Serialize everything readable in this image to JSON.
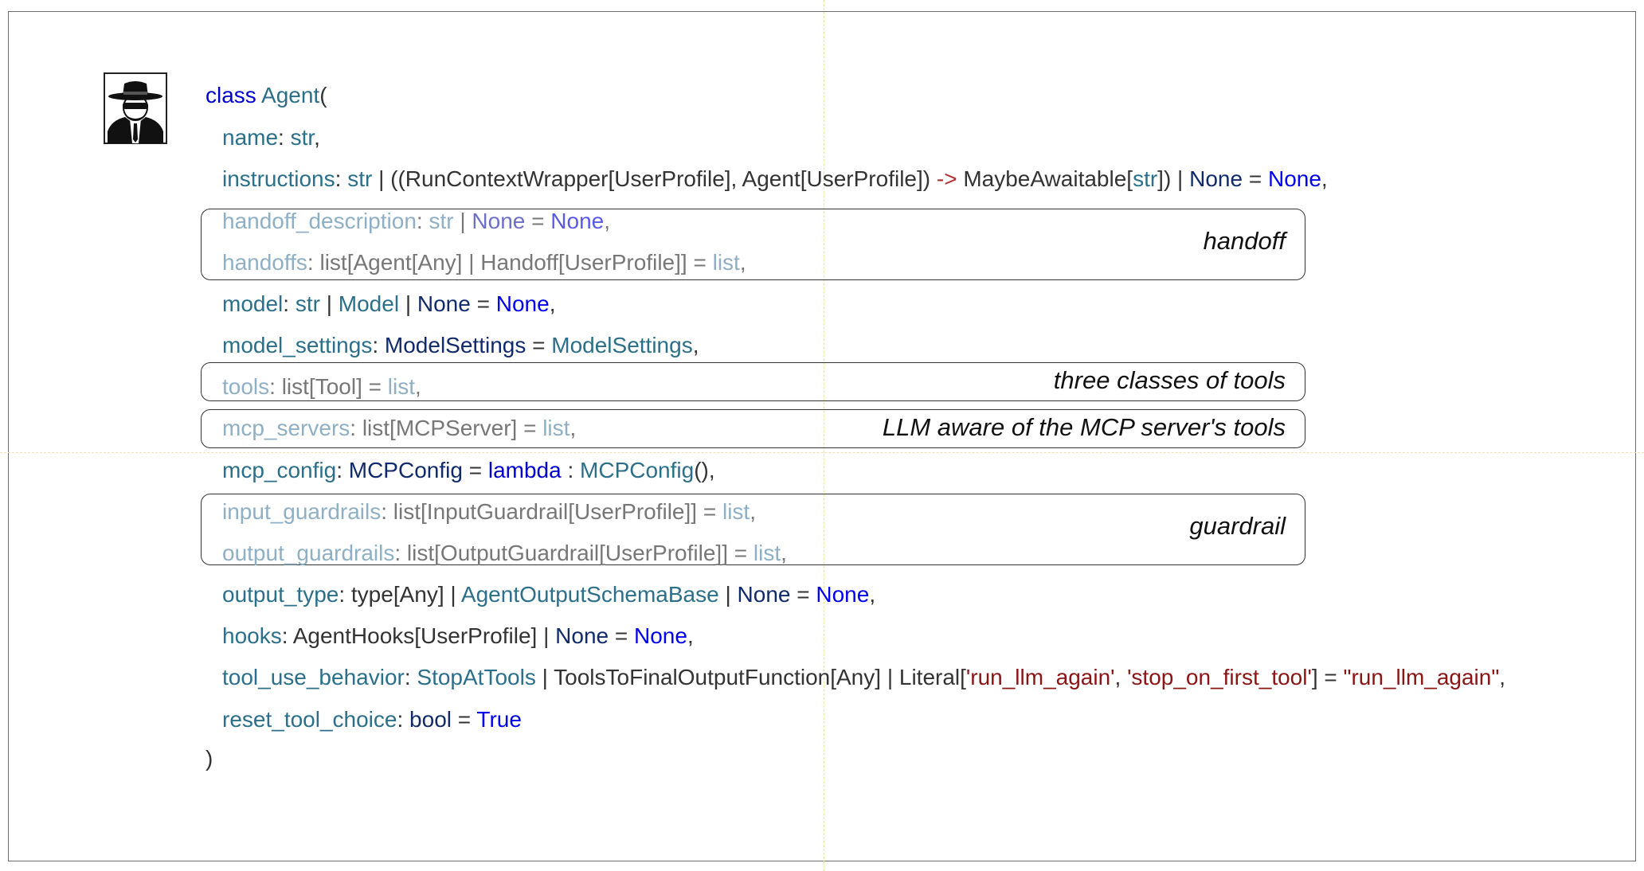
{
  "code": {
    "l0": {
      "a": "class",
      "b": "Agent",
      "c": "("
    },
    "l1": {
      "a": "name",
      "b": ": ",
      "c": "str",
      "d": ","
    },
    "l2": {
      "a": "instructions",
      "b": ": ",
      "c": "str",
      "d": " | ((RunContextWrapper[UserProfile], Agent[UserProfile]) ",
      "e": "->",
      "f": " MaybeAwaitable[",
      "g": "str",
      "h": "]) | ",
      "i": "None",
      "j": " = ",
      "k": "None",
      "l": ","
    },
    "l3": {
      "a": "handoff_description",
      "b": ": ",
      "c": "str",
      "d": " | ",
      "e": "None",
      "f": " = ",
      "g": "None",
      "h": ","
    },
    "l4": {
      "a": "handoffs",
      "b": ": list[Agent[Any] | Handoff[UserProfile]] = ",
      "c": "list",
      "d": ","
    },
    "l5": {
      "a": "model",
      "b": ": ",
      "c": "str",
      "d": " | ",
      "e": "Model",
      "f": " | ",
      "g": "None",
      "h": " = ",
      "i": "None",
      "j": ","
    },
    "l6": {
      "a": "model_settings",
      "b": ": ",
      "c": "ModelSettings",
      "d": " = ",
      "e": "ModelSettings",
      "f": ","
    },
    "l7": {
      "a": "tools",
      "b": ": list[Tool] = ",
      "c": "list",
      "d": ","
    },
    "l8": {
      "a": "mcp_servers",
      "b": ": list[MCPServer] = ",
      "c": "list",
      "d": ","
    },
    "l9": {
      "a": "mcp_config",
      "b": ": ",
      "c": "MCPConfig",
      "d": " = ",
      "e": "lambda",
      "f": " : ",
      "g": "MCPConfig",
      "h": "(),"
    },
    "l10": {
      "a": "input_guardrails",
      "b": ": list[InputGuardrail[UserProfile]] = ",
      "c": "list",
      "d": ","
    },
    "l11": {
      "a": "output_guardrails",
      "b": ": list[OutputGuardrail[UserProfile]] = ",
      "c": "list",
      "d": ","
    },
    "l12": {
      "a": "output_type",
      "b": ": type[Any] | ",
      "c": "AgentOutputSchemaBase",
      "d": " | ",
      "e": "None",
      "f": " = ",
      "g": "None",
      "h": ","
    },
    "l13": {
      "a": "hooks",
      "b": ": AgentHooks[UserProfile] | ",
      "c": "None",
      "d": " = ",
      "e": "None",
      "f": ","
    },
    "l14": {
      "a": "tool_use_behavior",
      "b": ": ",
      "c": "StopAtTools",
      "d": " | ToolsToFinalOutputFunction[Any] | Literal[",
      "e": "'run_llm_again'",
      "f": ", ",
      "g": "'stop_on_first_tool'",
      "h": "] = ",
      "i": "\"run_llm_again\"",
      "j": ","
    },
    "l15": {
      "a": "reset_tool_choice",
      "b": ": ",
      "c": "bool",
      "d": " = ",
      "e": "True"
    },
    "l16": {
      "a": ")"
    }
  },
  "annotations": {
    "handoff": "handoff",
    "tools": "three classes of tools",
    "mcp": "LLM aware of the MCP server's tools",
    "guardrail": "guardrail"
  },
  "icons": {
    "avatar": "spy-agent-icon"
  },
  "colors": {
    "keyword": "#0000cc",
    "param": "#2b6f8a",
    "type_navy": "#102a6b",
    "none_value": "#0000ee",
    "string": "#8b1414",
    "dimmed": "#8eafc4"
  }
}
